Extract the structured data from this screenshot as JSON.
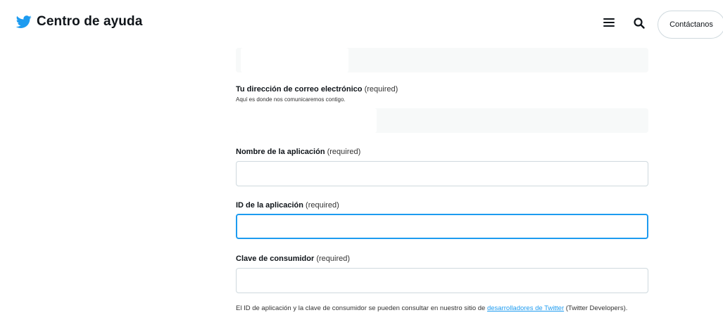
{
  "header": {
    "title": "Centro de ayuda",
    "contact_label": "Contáctanos",
    "icons": {
      "logo": "twitter-bird-icon",
      "menu": "hamburger-menu-icon",
      "search": "search-icon"
    },
    "brand_color": "#1d9bf0"
  },
  "form": {
    "email": {
      "label": "Tu dirección de correo electrónico",
      "required": "(required)",
      "help": "Aquí es donde nos comunicaremos contigo."
    },
    "app_name": {
      "label": "Nombre de la aplicación",
      "required": "(required)",
      "value": ""
    },
    "app_id": {
      "label": "ID de la aplicación",
      "required": "(required)",
      "value": ""
    },
    "consumer_key": {
      "label": "Clave de consumidor",
      "required": "(required)",
      "value": ""
    },
    "footnote": {
      "text_before": "El ID de aplicación y la clave de consumidor se pueden consultar en nuestro sitio de ",
      "link": "desarrolladores de Twitter",
      "text_after": " (Twitter Developers)."
    }
  },
  "colors": {
    "focus_border": "#1d9bf0",
    "field_bg": "#f7f9f9",
    "border": "#cfd9de"
  }
}
